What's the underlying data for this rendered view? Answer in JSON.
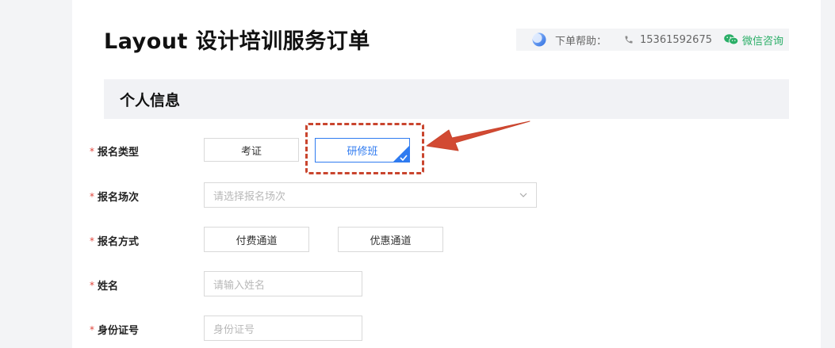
{
  "page": {
    "title": "Layout 设计培训服务订单"
  },
  "help": {
    "label": "下单帮助：",
    "phone": "15361592675",
    "wechat": "微信咨询",
    "logo_icon": "app-logo-icon",
    "phone_icon": "phone-icon",
    "wechat_icon": "wechat-icon"
  },
  "section": {
    "title": "个人信息"
  },
  "form": {
    "required_mark": "*",
    "signup_type": {
      "label": "报名类型",
      "options": [
        "考证",
        "研修班"
      ],
      "selected": "研修班"
    },
    "session": {
      "label": "报名场次",
      "placeholder": "请选择报名场次"
    },
    "method": {
      "label": "报名方式",
      "options": [
        "付费通道",
        "优惠通道"
      ]
    },
    "name": {
      "label": "姓名",
      "placeholder": "请输入姓名"
    },
    "id_number": {
      "label": "身份证号",
      "placeholder": "身份证号"
    }
  },
  "colors": {
    "accent": "#2f7bf0",
    "required": "#e0463c",
    "annotation": "#c9452e",
    "wechat": "#2aae67"
  }
}
